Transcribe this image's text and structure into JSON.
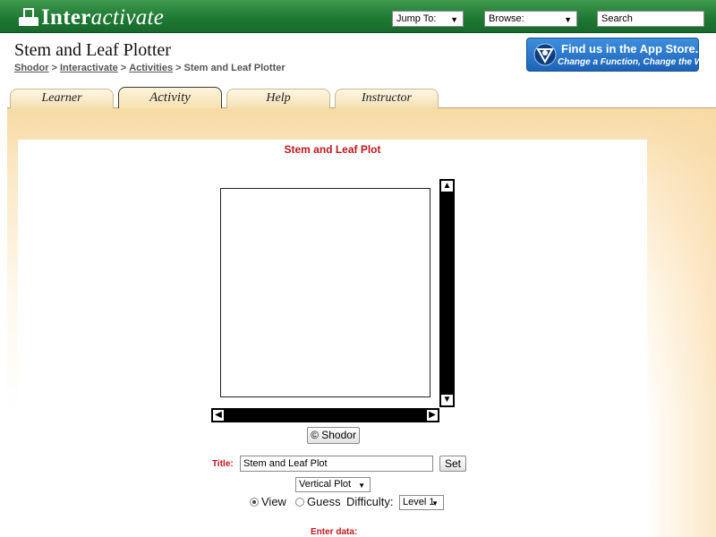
{
  "header": {
    "brand_first": "Inter",
    "brand_rest": "activate",
    "jump_to": "Jump To:",
    "browse": "Browse:",
    "search_placeholder": "Search"
  },
  "page": {
    "title": "Stem and Leaf Plotter",
    "breadcrumb": [
      {
        "label": "Shodor",
        "link": true
      },
      {
        "label": "Interactivate",
        "link": true
      },
      {
        "label": "Activities",
        "link": true
      },
      {
        "label": "Stem and Leaf Plotter",
        "link": false
      }
    ]
  },
  "appstore": {
    "line1": "Find us in the App Store.",
    "line2": "Change a Function, Change the World"
  },
  "tabs": [
    "Learner",
    "Activity",
    "Help",
    "Instructor"
  ],
  "active_tab": "Activity",
  "activity": {
    "plot_title": "Stem and Leaf Plot",
    "copyright_button": "© Shodor",
    "title_label": "Title:",
    "title_value": "Stem and Leaf Plot",
    "set_button": "Set",
    "plot_type": "Vertical Plot",
    "mode_view": "View",
    "mode_guess": "Guess",
    "selected_mode": "View",
    "difficulty_label": "Difficulty:",
    "difficulty_value": "Level 1",
    "enter_data_label": "Enter data:"
  },
  "colors": {
    "topbar_green": "#1f7a34",
    "accent_red": "#c2161c",
    "appstore_blue": "#1d63b8"
  }
}
